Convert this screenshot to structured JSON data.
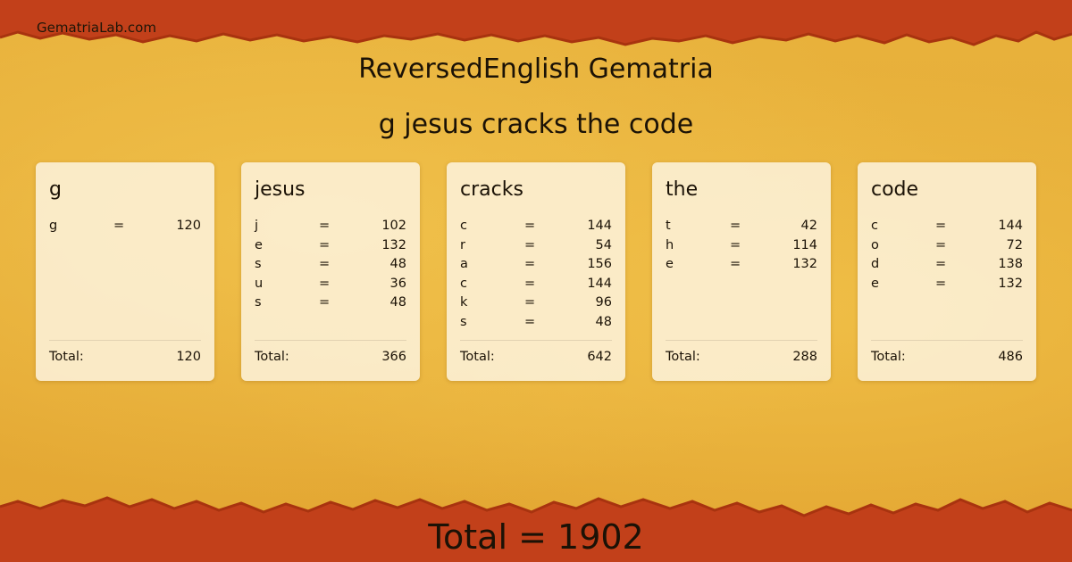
{
  "site_name": "GematriaLab.com",
  "title": "ReversedEnglish Gematria",
  "phrase": "g jesus cracks the code",
  "total_label": "Total:",
  "grand_total": "Total = 1902",
  "colors": {
    "border_red": "#c2401a",
    "background": "#e5ac35",
    "card": "#fdf3de"
  },
  "words": [
    {
      "word": "g",
      "letters": [
        {
          "l": "g",
          "eq": "=",
          "v": "120"
        }
      ],
      "total": "120"
    },
    {
      "word": "jesus",
      "letters": [
        {
          "l": "j",
          "eq": "=",
          "v": "102"
        },
        {
          "l": "e",
          "eq": "=",
          "v": "132"
        },
        {
          "l": "s",
          "eq": "=",
          "v": "48"
        },
        {
          "l": "u",
          "eq": "=",
          "v": "36"
        },
        {
          "l": "s",
          "eq": "=",
          "v": "48"
        }
      ],
      "total": "366"
    },
    {
      "word": "cracks",
      "letters": [
        {
          "l": "c",
          "eq": "=",
          "v": "144"
        },
        {
          "l": "r",
          "eq": "=",
          "v": "54"
        },
        {
          "l": "a",
          "eq": "=",
          "v": "156"
        },
        {
          "l": "c",
          "eq": "=",
          "v": "144"
        },
        {
          "l": "k",
          "eq": "=",
          "v": "96"
        },
        {
          "l": "s",
          "eq": "=",
          "v": "48"
        }
      ],
      "total": "642"
    },
    {
      "word": "the",
      "letters": [
        {
          "l": "t",
          "eq": "=",
          "v": "42"
        },
        {
          "l": "h",
          "eq": "=",
          "v": "114"
        },
        {
          "l": "e",
          "eq": "=",
          "v": "132"
        }
      ],
      "total": "288"
    },
    {
      "word": "code",
      "letters": [
        {
          "l": "c",
          "eq": "=",
          "v": "144"
        },
        {
          "l": "o",
          "eq": "=",
          "v": "72"
        },
        {
          "l": "d",
          "eq": "=",
          "v": "138"
        },
        {
          "l": "e",
          "eq": "=",
          "v": "132"
        }
      ],
      "total": "486"
    }
  ]
}
